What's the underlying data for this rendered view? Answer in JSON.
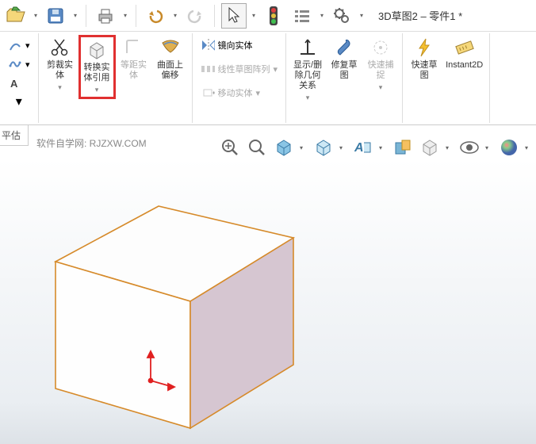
{
  "document": {
    "title": "3D草图2 – 零件1 *"
  },
  "top_toolbar": {
    "items": [
      "open",
      "save",
      "save-small",
      "print",
      "undo",
      "redo",
      "cursor",
      "lights",
      "list",
      "settings"
    ]
  },
  "ribbon": {
    "left_small": [
      "line",
      "text"
    ],
    "trim": "剪裁实\n体",
    "convert": "转换实\n体引用",
    "offset_surf": "等距实\n体",
    "offset_surface": "曲面上\n偏移",
    "mirror": "镜向实体",
    "pattern": "线性草图阵列",
    "move": "移动实体",
    "display_rel": "显示/删\n除几何\n关系",
    "repair": "修复草\n图",
    "rapid": "快速捕\n捉",
    "quick_sketch": "快速草\n图",
    "instant2d": "Instant2D"
  },
  "left": {
    "evaluate": "平估"
  },
  "watermark": "软件自学网: RJZXW.COM",
  "colors": {
    "highlight": "#e03030",
    "edge": "#d68a2a",
    "top_face": "#fdfdfd",
    "front_face": "#fefefe",
    "side_face": "#d6c6d1"
  }
}
